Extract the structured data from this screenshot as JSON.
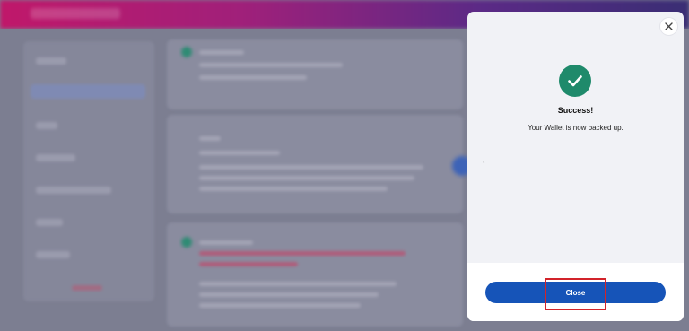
{
  "modal": {
    "title": "Success!",
    "message": "Your Wallet is now backed up.",
    "stray_mark": "`",
    "close_button_label": "Close",
    "close_icon": "close-icon",
    "status_icon": "checkmark-icon"
  },
  "colors": {
    "success": "#1f8a6b",
    "primary_button": "#1654b8",
    "highlight": "#d2232a"
  }
}
